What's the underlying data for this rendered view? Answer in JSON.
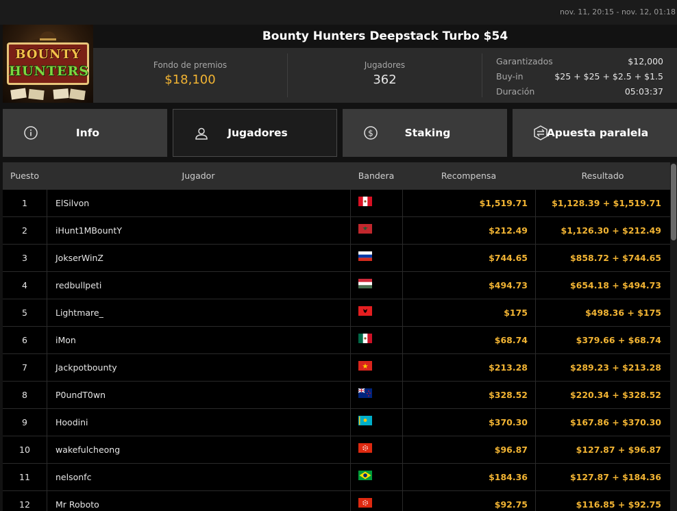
{
  "header": {
    "date_range": "nov. 11, 20:15 - nov. 12, 01:18",
    "title": "Bounty Hunters Deepstack Turbo $54",
    "logo_line1": "BOUNTY",
    "logo_line2": "HUNTERS"
  },
  "stats": {
    "prize_label": "Fondo de premios",
    "prize_value": "$18,100",
    "players_label": "Jugadores",
    "players_value": "362",
    "guaranteed_label": "Garantizados",
    "guaranteed_value": "$12,000",
    "buyin_label": "Buy-in",
    "buyin_value": "$25 + $25 + $2.5 + $1.5",
    "duration_label": "Duración",
    "duration_value": "05:03:37"
  },
  "tabs": [
    {
      "label": "Info",
      "icon": "info-icon",
      "active": false
    },
    {
      "label": "Jugadores",
      "icon": "user-icon",
      "active": true
    },
    {
      "label": "Staking",
      "icon": "dollar-coin-icon",
      "active": false
    },
    {
      "label": "Apuesta paralela",
      "icon": "side-bet-icon",
      "active": false
    }
  ],
  "table": {
    "columns": {
      "rank": "Puesto",
      "player": "Jugador",
      "flag": "Bandera",
      "reward": "Recompensa",
      "result": "Resultado"
    },
    "rows": [
      {
        "rank": "1",
        "player": "ElSilvon",
        "flag": "peru-flag",
        "reward": "$1,519.71",
        "result": "$1,128.39 + $1,519.71"
      },
      {
        "rank": "2",
        "player": "iHunt1MBountY",
        "flag": "morocco-flag",
        "reward": "$212.49",
        "result": "$1,126.30 + $212.49"
      },
      {
        "rank": "3",
        "player": "JokserWinZ",
        "flag": "russia-flag",
        "reward": "$744.65",
        "result": "$858.72 + $744.65"
      },
      {
        "rank": "4",
        "player": "redbullpeti",
        "flag": "hungary-flag",
        "reward": "$494.73",
        "result": "$654.18 + $494.73"
      },
      {
        "rank": "5",
        "player": "Lightmare_",
        "flag": "albania-flag",
        "reward": "$175",
        "result": "$498.36 + $175"
      },
      {
        "rank": "6",
        "player": "iMon",
        "flag": "mexico-flag",
        "reward": "$68.74",
        "result": "$379.66 + $68.74"
      },
      {
        "rank": "7",
        "player": "Jackpotbounty",
        "flag": "vietnam-flag",
        "reward": "$213.28",
        "result": "$289.23 + $213.28"
      },
      {
        "rank": "8",
        "player": "P0undT0wn",
        "flag": "new-zealand-flag",
        "reward": "$328.52",
        "result": "$220.34 + $328.52"
      },
      {
        "rank": "9",
        "player": "Hoodini",
        "flag": "kazakhstan-flag",
        "reward": "$370.30",
        "result": "$167.86 + $370.30"
      },
      {
        "rank": "10",
        "player": "wakefulcheong",
        "flag": "hong-kong-flag",
        "reward": "$96.87",
        "result": "$127.87 + $96.87"
      },
      {
        "rank": "11",
        "player": "nelsonfc",
        "flag": "brazil-flag",
        "reward": "$184.36",
        "result": "$127.87 + $184.36"
      },
      {
        "rank": "12",
        "player": "Mr Roboto",
        "flag": "hong-kong-flag",
        "reward": "$92.75",
        "result": "$116.85 + $92.75"
      }
    ]
  },
  "colors": {
    "accent_gold": "#f2b433",
    "background": "#121212",
    "panel": "#2b2b2b",
    "row_bg": "#000000"
  }
}
